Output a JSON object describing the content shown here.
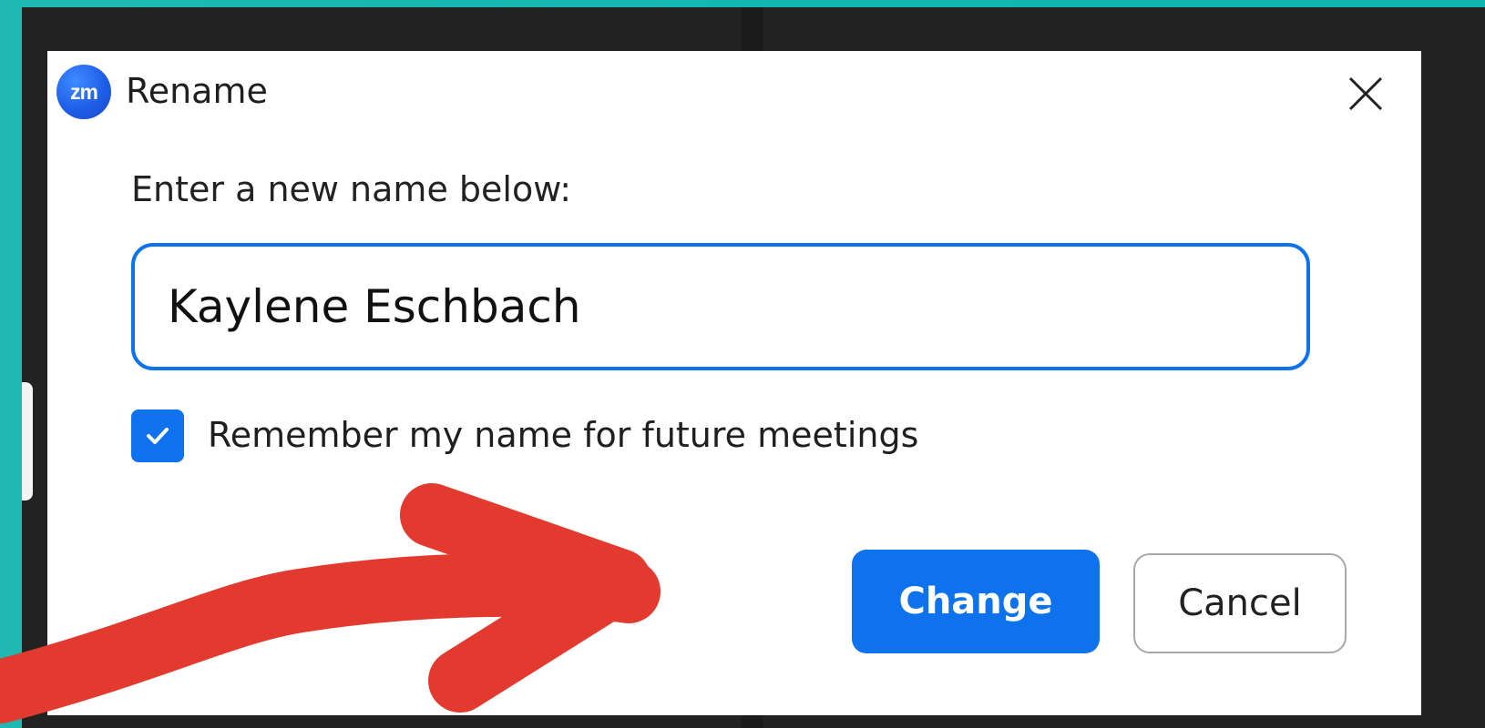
{
  "dialog": {
    "title": "Rename",
    "logo_text": "zm",
    "close_icon": "close-icon",
    "prompt": "Enter a new name below:",
    "name_value": "Kaylene Eschbach",
    "remember_checked": true,
    "remember_label": "Remember my name for future meetings",
    "change_label": "Change",
    "cancel_label": "Cancel"
  },
  "colors": {
    "accent": "#0e72ed",
    "annotation_arrow": "#e23a2e",
    "background_teal": "#12b8b0",
    "window_dark": "#222222"
  }
}
